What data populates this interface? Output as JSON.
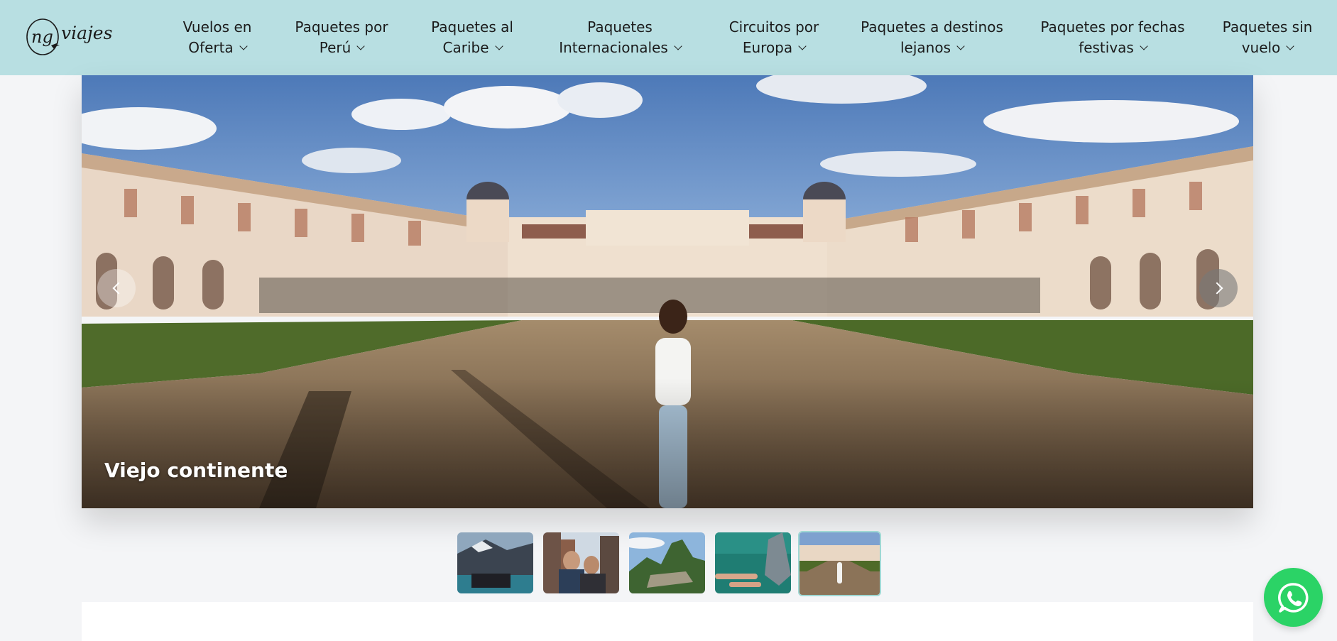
{
  "brand": {
    "logo_text_ng": "ng",
    "logo_text_viajes": "viajes"
  },
  "nav": {
    "items": [
      {
        "line1": "Vuelos en",
        "line2": "Oferta"
      },
      {
        "line1": "Paquetes por",
        "line2": "Perú"
      },
      {
        "line1": "Paquetes al",
        "line2": "Caribe"
      },
      {
        "line1": "Paquetes",
        "line2": "Internacionales"
      },
      {
        "line1": "Circuitos por",
        "line2": "Europa"
      },
      {
        "line1": "Paquetes a destinos",
        "line2": "lejanos"
      },
      {
        "line1": "Paquetes por fechas",
        "line2": "festivas"
      },
      {
        "line1": "Paquetes sin",
        "line2": "vuelo"
      }
    ]
  },
  "hero": {
    "caption": "Viejo continente",
    "active_slide": 5,
    "slide_count": 5
  },
  "colors": {
    "header_bg": "#b8dfe2",
    "page_bg": "#f4f5f7",
    "whatsapp": "#2bd366",
    "active_thumb_border": "#9fd8d4"
  },
  "icons": {
    "prev": "chevron-left-icon",
    "next": "chevron-right-icon",
    "nav_dropdown": "chevron-down-icon",
    "whatsapp": "whatsapp-icon"
  }
}
